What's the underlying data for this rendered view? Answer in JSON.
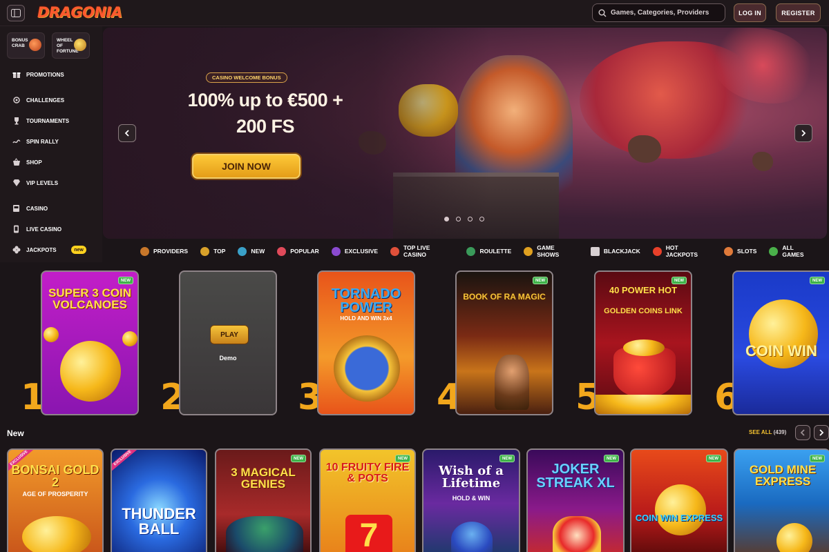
{
  "header": {
    "logo": "DRAGONIA",
    "search_placeholder": "Games, Categories, Providers",
    "login_label": "LOG IN",
    "register_label": "REGISTER"
  },
  "sidebar": {
    "mini_cards": [
      {
        "label_line1": "BONUS",
        "label_line2": "CRAB"
      },
      {
        "label_line1": "WHEEL",
        "label_line2": "OF",
        "label_line3": "FORTUNE"
      }
    ],
    "items": [
      {
        "label": "PROMOTIONS",
        "icon": "gift-icon"
      },
      {
        "label": "CHALLENGES",
        "icon": "medal-icon"
      },
      {
        "label": "TOURNAMENTS",
        "icon": "trophy-icon"
      },
      {
        "label": "SPIN RALLY",
        "icon": "rally-icon"
      },
      {
        "label": "SHOP",
        "icon": "basket-icon"
      },
      {
        "label": "VIP LEVELS",
        "icon": "diamond-icon"
      },
      {
        "label": "CASINO",
        "icon": "slot-machine-icon"
      },
      {
        "label": "LIVE CASINO",
        "icon": "phone-cards-icon"
      },
      {
        "label": "JACKPOTS",
        "icon": "clover-icon",
        "badge": "new"
      }
    ]
  },
  "hero": {
    "pill": "CASINO WELCOME BONUS",
    "title_line1": "100% up to €500 +",
    "title_line2": "200 FS",
    "cta": "JOIN NOW",
    "slides": 4,
    "active_slide": 1
  },
  "categories": [
    {
      "label": "PROVIDERS",
      "color": "#c8772a"
    },
    {
      "label": "TOP",
      "color": "#d9a12a"
    },
    {
      "label": "NEW",
      "color": "#3aa0c8"
    },
    {
      "label": "POPULAR",
      "color": "#e04a5a"
    },
    {
      "label": "EXCLUSIVE",
      "color": "#8a4ad0"
    },
    {
      "label": "TOP LIVE CASINO",
      "color": "#e0503a"
    },
    {
      "label": "ROULETTE",
      "color": "#3a9a5a"
    },
    {
      "label": "GAME SHOWS",
      "color": "#e0a020"
    },
    {
      "label": "BLACKJACK",
      "color": "#d8d0d2"
    },
    {
      "label": "HOT JACKPOTS",
      "color": "#e8402a"
    },
    {
      "label": "SLOTS",
      "color": "#e07a3a"
    },
    {
      "label": "ALL GAMES",
      "color": "#4ab04a"
    }
  ],
  "top_games": [
    {
      "rank": "1",
      "title": "SUPER 3 COIN VOLCANOES",
      "tag": "NEW"
    },
    {
      "rank": "2",
      "title": "",
      "play": "PLAY",
      "demo": "Demo"
    },
    {
      "rank": "3",
      "title": "TORNADO POWER",
      "subtitle": "HOLD AND WIN 3x4"
    },
    {
      "rank": "4",
      "title": "BOOK OF RA MAGIC",
      "tag": "NEW"
    },
    {
      "rank": "5",
      "title": "40 POWER HOT",
      "subtitle": "GOLDEN COINS LINK",
      "tag": "NEW"
    },
    {
      "rank": "6",
      "title": "COIN WIN",
      "tag": "NEW"
    }
  ],
  "new_section": {
    "title": "New",
    "see_all": "SEE ALL",
    "count": "(439)",
    "games": [
      {
        "title": "BONSAI GOLD 2",
        "subtitle": "AGE OF PROSPERITY",
        "exclusive": "EXCLUSIVE"
      },
      {
        "title": "THUNDER BALL",
        "exclusive": "EXCLUSIVE"
      },
      {
        "title": "3 MAGICAL GENIES",
        "tag": "NEW"
      },
      {
        "title": "10 FRUITY FIRE & POTS",
        "tag": "NEW"
      },
      {
        "title": "Wish of a Lifetime",
        "subtitle": "HOLD & WIN",
        "tag": "NEW"
      },
      {
        "title": "JOKER STREAK XL",
        "tag": "NEW"
      },
      {
        "title": "COIN WIN EXPRESS",
        "tag": "NEW"
      },
      {
        "title": "GOLD MINE EXPRESS",
        "tag": "NEW"
      }
    ]
  }
}
